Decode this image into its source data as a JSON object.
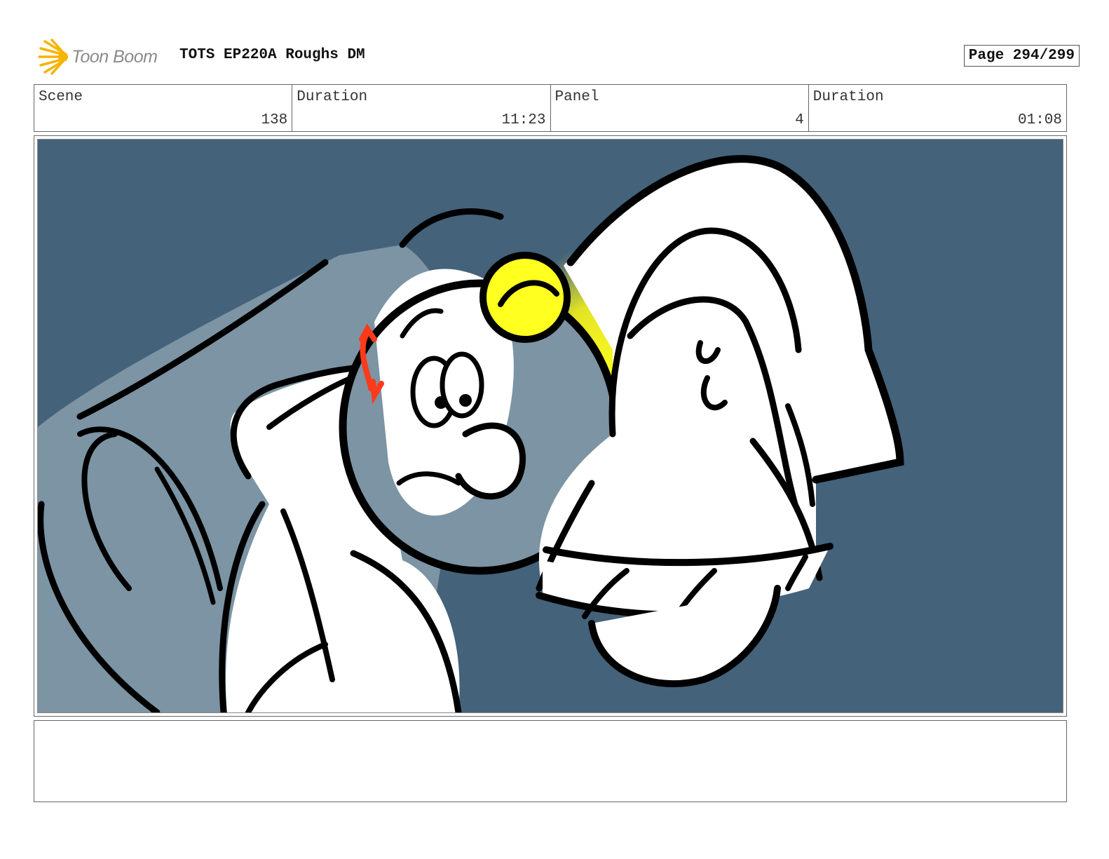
{
  "header": {
    "logo_text": "Toon Boom",
    "title": "TOTS EP220A Roughs DM",
    "page_label": "Page 294/299"
  },
  "info": [
    {
      "label": "Scene",
      "value": "138"
    },
    {
      "label": "Duration",
      "value": "11:23"
    },
    {
      "label": "Panel",
      "value": "4"
    },
    {
      "label": "Duration",
      "value": "01:08"
    }
  ],
  "panel": {
    "background_color": "#44627a",
    "highlight_color": "#ffff20",
    "accent_color": "#ff3a1a",
    "shadow_color": "#7c94a3"
  },
  "notes": {
    "text": ""
  }
}
